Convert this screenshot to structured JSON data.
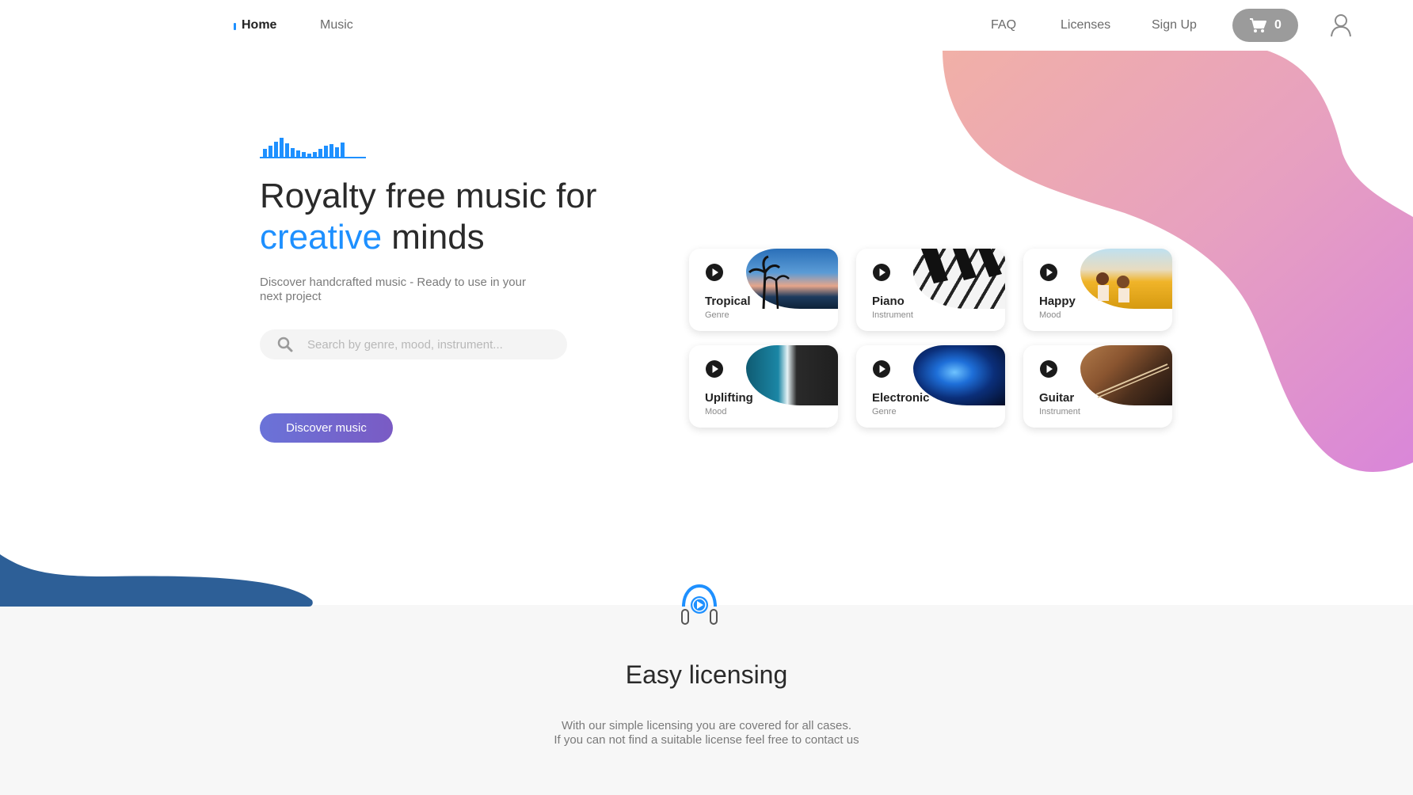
{
  "nav": {
    "home": "Home",
    "music": "Music",
    "faq": "FAQ",
    "licenses": "Licenses",
    "signup": "Sign Up",
    "cart_count": "0"
  },
  "hero": {
    "title_line1": "Royalty free music for",
    "title_accent": "creative",
    "title_rest": " minds",
    "subtitle_line1": "Discover handcrafted music - Ready to use in your",
    "subtitle_line2": "next project",
    "search_placeholder": "Search by genre, mood, instrument...",
    "cta": "Discover music"
  },
  "cards": [
    {
      "title": "Tropical",
      "type": "Genre"
    },
    {
      "title": "Piano",
      "type": "Instrument"
    },
    {
      "title": "Happy",
      "type": "Mood"
    },
    {
      "title": "Uplifting",
      "type": "Mood"
    },
    {
      "title": "Electronic",
      "type": "Genre"
    },
    {
      "title": "Guitar",
      "type": "Instrument"
    }
  ],
  "licensing": {
    "title": "Easy licensing",
    "text_line1": "With our simple licensing you are covered for all cases.",
    "text_line2": "If you can not find a suitable license feel free to contact us"
  },
  "colors": {
    "accent": "#1e90ff",
    "cta_start": "#6a73d8",
    "cta_end": "#7a5bc4",
    "blob_top": "#f1b0a7",
    "blob_bottom": "#d986d9",
    "wave": "#2d5f97"
  },
  "icons": [
    "cart-icon",
    "user-icon",
    "search-icon",
    "play-icon",
    "headphones-icon",
    "equalizer-logo"
  ]
}
